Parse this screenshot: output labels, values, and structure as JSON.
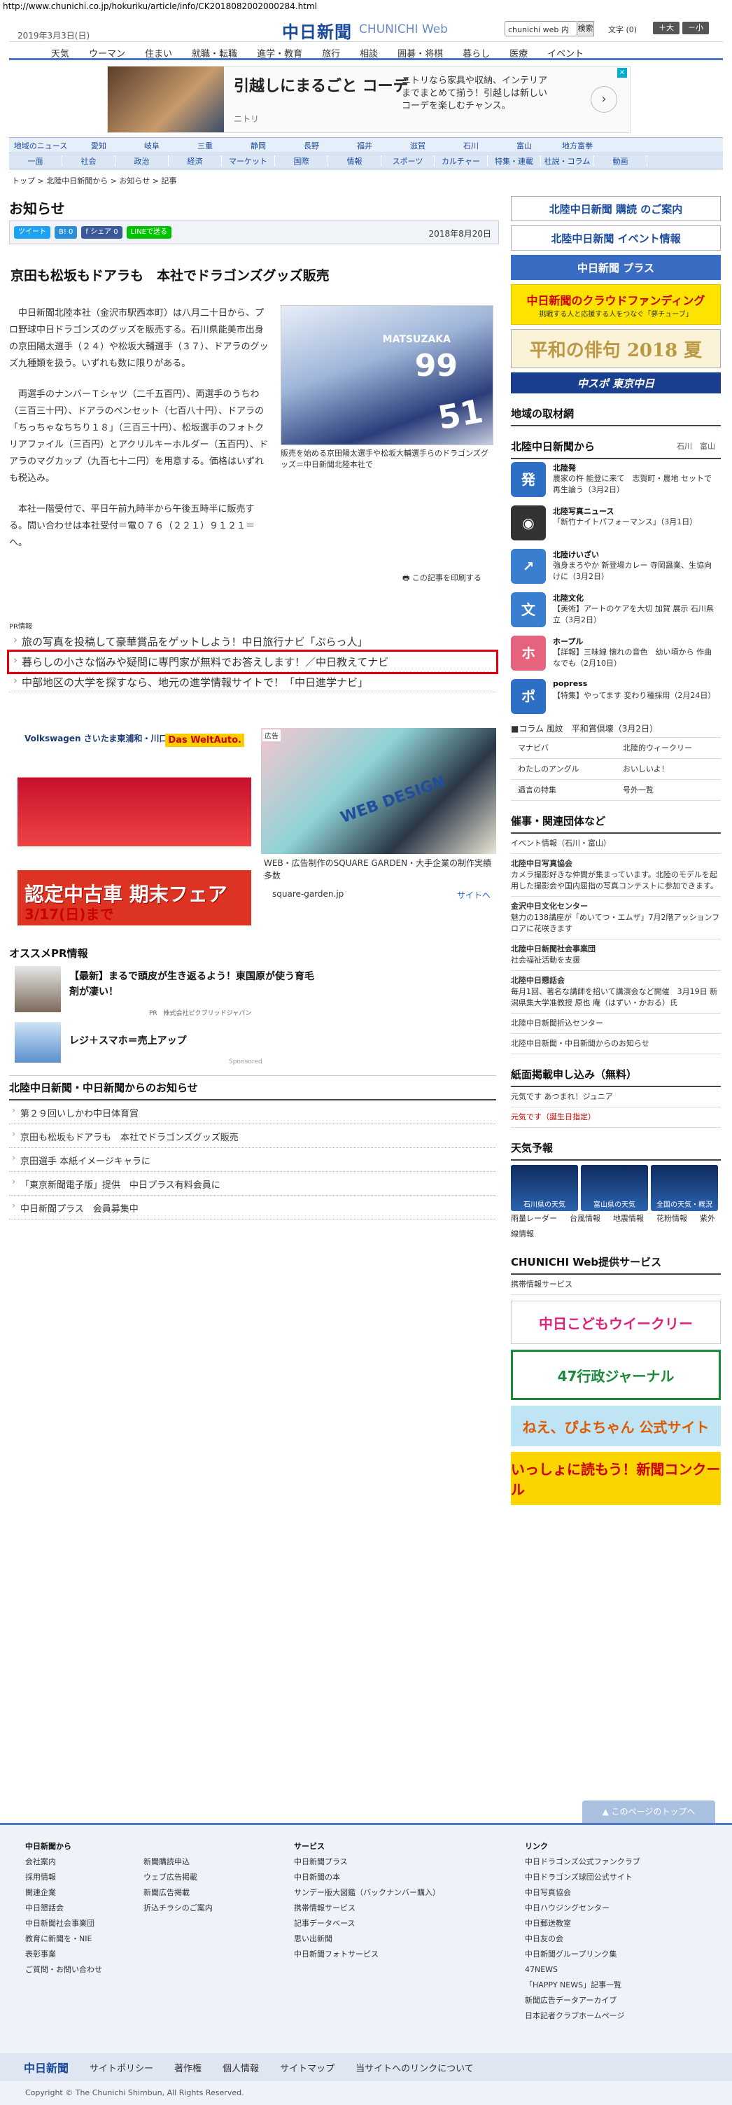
{
  "url": "http://www.chunichi.co.jp/hokuriku/article/info/CK2018082002000284.html",
  "header": {
    "date": "2019年3月3日(日)",
    "logo": "中日新聞",
    "logo_sub": "CHUNICHI Web",
    "search_value": "chunichi web 内",
    "search_btn": "検索",
    "font_size": "文字 (0)",
    "big": "＋大",
    "small": "－小"
  },
  "gnav": [
    "天気",
    "ウーマン",
    "住まい",
    "就職・転職",
    "進学・教育",
    "旅行",
    "相談",
    "囲碁・将棋",
    "暮らし",
    "医療",
    "イベント"
  ],
  "ad_top": {
    "t1": "引越しにまるごと コーデ",
    "t2": "ニトリ",
    "t3": "ニトリなら家具や収納、インテリアまでまとめて揃う！引越しは新しいコーデを楽しむチャンス。"
  },
  "rnav": [
    "地域のニュース",
    "愛知",
    "岐阜",
    "三重",
    "静岡",
    "長野",
    "福井",
    "滋賀",
    "石川",
    "富山",
    "地方富拳"
  ],
  "snav": [
    "一面",
    "社会",
    "政治",
    "経済",
    "マーケット",
    "国際",
    "情報",
    "スポーツ",
    "カルチャー",
    "特集・連載",
    "社説・コラム",
    "動画"
  ],
  "crumb": "トップ > 北陸中日新聞から > お知らせ > 記事",
  "section": "お知らせ",
  "share": {
    "tweet": "ツイート",
    "b": "B! 0",
    "fb": "f シェア 0",
    "line": "LINEで送る",
    "date": "2018年8月20日"
  },
  "article": {
    "title": "京田も松坂もドアラも　本社でドラゴンズグッズ販売",
    "p1": "中日新聞北陸本社（金沢市駅西本町）は八月二十日から、プロ野球中日ドラゴンズのグッズを販売する。石川県能美市出身の京田陽太選手（２４）や松坂大輔選手（３７）、ドアラのグッズ九種類を扱う。いずれも数に限りがある。",
    "p2": "両選手のナンバーＴシャツ（二千五百円）、両選手のうちわ（三百三十円）、ドアラのペンセット（七百八十円）、ドアラの「ちっちゃなちちり１８」（三百三十円）、松坂選手のフォトクリアファイル（三百円）とアクリルキーホルダー（五百円）、ドアラのマグカップ（九百七十二円）を用意する。価格はいずれも税込み。",
    "p3": "本社一階受付で、平日午前九時半から午後五時半に販売する。問い合わせは本社受付＝電０７６（２２１）９１２１＝へ。",
    "caption": "販売を始める京田陽太選手や松坂大輔選手らのドラゴンズグッズ＝中日新聞北陸本社で",
    "print": "この記事を印刷する"
  },
  "pr": {
    "label": "PR情報",
    "items": [
      "旅の写真を投稿して豪華賞品をゲットしよう！中日旅行ナビ「ぷらっ人」",
      "暮らしの小さな悩みや疑問に専門家が無料でお答えします！／中日教えてナビ",
      "中部地区の大学を探すなら、地元の進学情報サイトで！「中日進学ナビ」"
    ]
  },
  "ad_vw": {
    "brand": "Volkswagen さいたま東浦和・川口店",
    "da": "Das WeltAuto.",
    "big": "認定中古車 期末フェア",
    "date": "3/17(日)まで"
  },
  "ad_web": {
    "tag": "広告",
    "word": "WEB DESIGN",
    "caption": "WEB・広告制作のSQUARE GARDEN・大手企業の制作実績多数",
    "site": "square-garden.jp",
    "link": "サイトへ"
  },
  "rec": {
    "title": "オススメPR情報",
    "t1": "【最新】まるで頭皮が生き返るよう！東国原が使う育毛剤が凄い！",
    "s1": "PR　株式会社ピクブリッドジャパン",
    "t2": "レジ＋スマホ＝売上アップ",
    "spons": "Sponsored"
  },
  "news": {
    "title": "北陸中日新聞・中日新聞からのお知らせ",
    "items": [
      "第２９回いしかわ中日体育賞",
      "京田も松坂もドアラも　本社でドラゴンズグッズ販売",
      "京田選手 本紙イメージキャラに",
      "「東京新聞電子版」提供　中日プラス有料会員に",
      "中日新聞プラス　会員募集中"
    ]
  },
  "side": {
    "b1": "北陸中日新聞 購読 のご案内",
    "b2": "北陸中日新聞 イベント情報",
    "b3": "中日新聞 プラス",
    "b4": "中日新聞のクラウドファンディング",
    "b4s": "挑戦する人と応援する人をつなぐ「夢チューブ」",
    "b5": "平和の俳句 2018 夏",
    "b6": "中スポ 東京中日",
    "local": "地域の取材網",
    "from": "北陸中日新聞から",
    "from_s": "石川　富山",
    "blocks": [
      {
        "name": "北陸発",
        "text": "農家の杵 能登に来て　志賀町・農地 セットで再生論う（3月2日）",
        "icon": "発",
        "color": "#2d6fc4"
      },
      {
        "name": "北陸写真ニュース",
        "text": "「新竹ナイトパフォーマンス」（3月1日）",
        "icon": "◉",
        "color": "#333"
      },
      {
        "name": "北陸けいざい",
        "text": "強身まろやか 新登場カレー 寺岡醤業、生協向けに（3月2日）",
        "icon": "↗",
        "color": "#3a7ed0"
      },
      {
        "name": "北陸文化",
        "text": "【美術】アートのケアを大切 加賀 展示 石川県立（3月2日）",
        "icon": "文",
        "color": "#3a7ed0"
      },
      {
        "name": "ホープル",
        "text": "【詳報】三味線 懐れの音色　幼い頃から 作曲なでも（2月10日）",
        "icon": "ホ",
        "color": "#e6637d"
      },
      {
        "name": "popress",
        "text": "【特集】やってます 変わり種採用（2月24日）",
        "icon": "ポ",
        "color": "#2d6fc4"
      }
    ],
    "coram": "■コラム 風紋　平和賞倶壊（3月2日）",
    "grid": [
      "マナビバ",
      "北陸的ウィークリー",
      "わたしのアングル",
      "おいしいよ！",
      "逓言の特集",
      "号外一覧"
    ],
    "event_h": "催事・関連団体など",
    "event_link": "イベント情報（石川・富山）",
    "events": [
      {
        "b": "北陸中日写真協会",
        "t": "カメラ撮影好きな仲間が集まっています。北陸のモデルを起用した撮影会や国内屈指の写真コンテストに参加できます。"
      },
      {
        "b": "金沢中日文化センター",
        "t": "魅力の138講座が「めいてつ・エムザ」7月2階アッションフロアに花咲きます"
      },
      {
        "b": "北陸中日新聞社会事業団",
        "t": "社会福祉活動を支援"
      },
      {
        "b": "北陸中日懇話会",
        "t": "毎月1回、著名な講師を招いて講演会など開催　3月19日 新潟県集大学准教授 原也 庵（はずい・かおる）氏"
      },
      {
        "b": "",
        "t": "北陸中日新聞折込センター"
      },
      {
        "b": "",
        "t": "北陸中日新聞・中日新聞からのお知らせ"
      }
    ],
    "shimen_h": "紙面掲載申し込み（無料）",
    "shimen": [
      "元気です あつまれ！ジュニア",
      "元気です（誕生日指定）"
    ],
    "weather_h": "天気予報",
    "weather": [
      "石川県の天気",
      "富山県の天気",
      "全国の天気・概況"
    ],
    "wlinks": [
      "雨量レーダー",
      "台風情報",
      "地震情報",
      "花粉情報",
      "紫外線情報"
    ],
    "svc_h": "CHUNICHI Web提供サービス",
    "svc": "携帯情報サービス",
    "c1": "中日こどもウイークリー",
    "c2": "47行政ジャーナル",
    "c3": "ねえ、ぴよちゃん 公式サイト",
    "c4": "いっしょに読もう！新聞コンクール"
  },
  "footer": {
    "top": "▲ このページのトップへ",
    "col1_h": "中日新聞から",
    "col1": [
      "会社案内",
      "採用情報",
      "関連企業",
      "中日懇話会",
      "中日新聞社会事業団",
      "教育に新聞を・NIE",
      "表彰事業",
      "ご質問・お問い合わせ"
    ],
    "col2": [
      "新聞購読申込",
      "ウェブ広告掲載",
      "新聞広告掲載",
      "折込チラシのご案内"
    ],
    "col3_h": "サービス",
    "col3": [
      "中日新聞プラス",
      "中日新聞の本",
      "サンデー版大図鑑（バックナンバー購入）",
      "携帯情報サービス",
      "記事データベース",
      "思い出新聞",
      "中日新聞フォトサービス"
    ],
    "col4_h": "リンク",
    "col4": [
      "中日ドラゴンズ公式ファンクラブ",
      "中日ドラゴンズ球団公式サイト",
      "中日写真協会",
      "中日ハウジングセンター",
      "中日郵送教室",
      "中日友の会",
      "中日新聞グループリンク集",
      "47NEWS",
      "「HAPPY NEWS」記事一覧",
      "新聞広告データアーカイブ",
      "日本記者クラブホームページ"
    ],
    "bar": [
      "中日新聞",
      "サイトポリシー",
      "著作権",
      "個人情報",
      "サイトマップ",
      "当サイトへのリンクについて"
    ],
    "copy": "Copyright © The Chunichi Shimbun, All Rights Reserved."
  }
}
